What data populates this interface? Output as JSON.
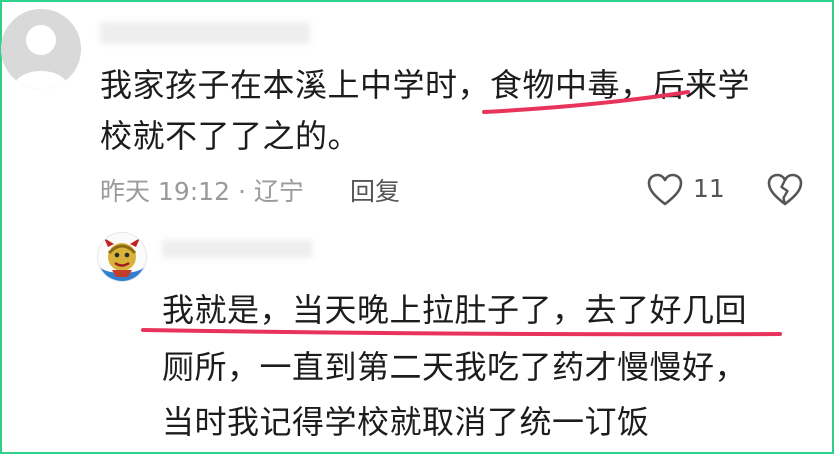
{
  "comment": {
    "text_line1": "我家孩子在本溪上中学时，食物中毒，后来学",
    "text_line2": "校就不了了之的。",
    "meta": "昨天 19:12 · 辽宁",
    "reply_label": "回复",
    "like_count": "11",
    "icons": {
      "avatar": "avatar-placeholder",
      "like": "heart-icon",
      "dislike": "broken-heart-icon"
    }
  },
  "reply": {
    "text_line1": "我就是，当天晚上拉肚子了，去了好几回",
    "text_line2": "厕所，一直到第二天我吃了药才慢慢好，",
    "text_line3": "当时我记得学校就取消了统一订饭"
  },
  "colors": {
    "border": "#2fd08a",
    "underline": "#e8335a",
    "text": "#1c1c1c",
    "meta": "#9a9a9a"
  }
}
